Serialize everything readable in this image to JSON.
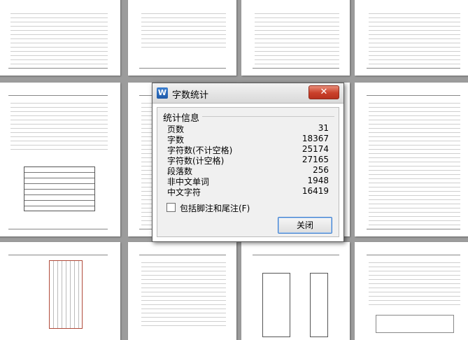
{
  "dialog": {
    "title": "字数统计",
    "app_icon_letter": "W",
    "close_glyph": "✕",
    "group_label": "统计信息",
    "stats": [
      {
        "label": "页数",
        "value": "31"
      },
      {
        "label": "字数",
        "value": "18367"
      },
      {
        "label": "字符数(不计空格)",
        "value": "25174"
      },
      {
        "label": "字符数(计空格)",
        "value": "27165"
      },
      {
        "label": "段落数",
        "value": "256"
      },
      {
        "label": "非中文单词",
        "value": "1948"
      },
      {
        "label": "中文字符",
        "value": "16419"
      }
    ],
    "footnote_checkbox": {
      "label": "包括脚注和尾注(F)",
      "checked": false
    },
    "close_button_label": "关闭"
  },
  "colors": {
    "workspace_bg": "#9c9c9c",
    "close_red": "#c9402a",
    "accent_blue": "#3c7fd0"
  }
}
